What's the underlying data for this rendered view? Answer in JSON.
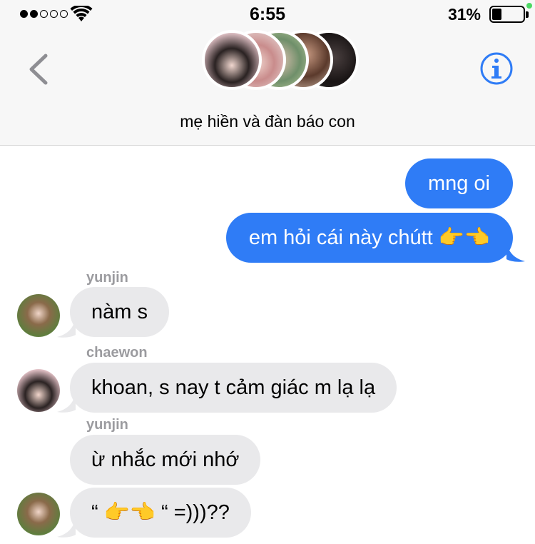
{
  "status_bar": {
    "time": "6:55",
    "battery_percent": "31%",
    "battery_level": 0.31,
    "signal_bars_filled": 2,
    "signal_bars_total": 5
  },
  "header": {
    "group_name": "mẹ hiền và đàn báo con",
    "back_icon": "chevron-left-icon",
    "info_icon": "info-circle-icon"
  },
  "messages": [
    {
      "direction": "outgoing",
      "text": "mng oi"
    },
    {
      "direction": "outgoing",
      "text": "em hỏi cái này chútt 👉👈"
    },
    {
      "direction": "incoming",
      "sender": "yunjin",
      "text": "nàm s"
    },
    {
      "direction": "incoming",
      "sender": "chaewon",
      "text": "khoan, s nay t cảm giác m lạ lạ"
    },
    {
      "direction": "incoming",
      "sender": "yunjin",
      "text": "ừ nhắc mới nhớ"
    },
    {
      "direction": "incoming",
      "text": "“ 👉👈 “ =)))??"
    }
  ],
  "colors": {
    "outgoing_bubble": "#2f7cf6",
    "incoming_bubble": "#e9e9eb",
    "accent": "#2f7cf6",
    "sender_name": "#9b9b9f"
  }
}
